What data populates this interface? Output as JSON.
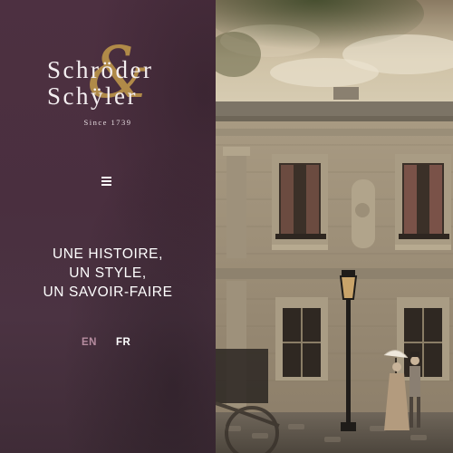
{
  "brand": {
    "line1": "Schröder",
    "line2": "Schÿler",
    "ampersand": "&",
    "since": "Since 1739",
    "accent_color": "#b08a48"
  },
  "menu": {
    "icon": "hamburger-menu-icon"
  },
  "tagline": {
    "line1": "UNE HISTOIRE,",
    "line2": "UN STYLE,",
    "line3": "UN SAVOIR-FAIRE"
  },
  "languages": {
    "en": "EN",
    "fr": "FR",
    "active": "FR"
  },
  "colors": {
    "panel": "#4a2f3f",
    "inactive_lang": "#b68da0"
  }
}
